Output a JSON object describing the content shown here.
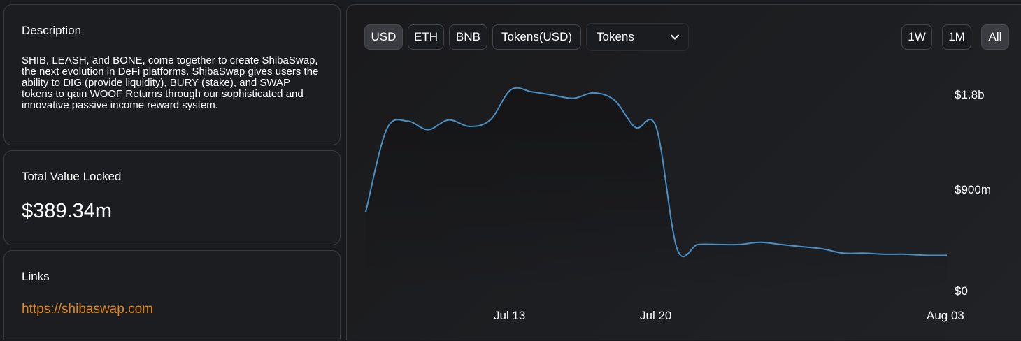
{
  "description": {
    "title": "Description",
    "text": "SHIB, LEASH, and BONE, come together to create ShibaSwap, the next evolution in DeFi platforms. ShibaSwap gives users the ability to DIG (provide liquidity), BURY (stake), and SWAP tokens to gain WOOF Returns through our sophisticated and innovative passive income reward system."
  },
  "tvl": {
    "title": "Total Value Locked",
    "value": "$389.34m"
  },
  "links": {
    "title": "Links",
    "url": "https://shibaswap.com"
  },
  "toolbar": {
    "currency_buttons": [
      "USD",
      "ETH",
      "BNB",
      "Tokens(USD)"
    ],
    "active_currency": "USD",
    "select_value": "Tokens",
    "range_buttons": [
      "1W",
      "1M",
      "All"
    ],
    "active_range": "All"
  },
  "colors": {
    "line": "#4a8fc4",
    "link": "#e0871c"
  },
  "chart_data": {
    "type": "area",
    "y_tick_labels": [
      "$1.8b",
      "$900m",
      "$0"
    ],
    "x_tick_labels": [
      "Jul 13",
      "Jul 20",
      "Aug 03"
    ],
    "ylim": [
      0,
      1800000000
    ],
    "x": [
      "Jul 6",
      "Jul 7",
      "Jul 8",
      "Jul 9",
      "Jul 10",
      "Jul 11",
      "Jul 12",
      "Jul 13",
      "Jul 14",
      "Jul 15",
      "Jul 16",
      "Jul 17",
      "Jul 18",
      "Jul 19",
      "Jul 20",
      "Jul 21",
      "Jul 22",
      "Jul 23",
      "Jul 24",
      "Jul 25",
      "Jul 26",
      "Jul 27",
      "Jul 28",
      "Jul 29",
      "Jul 30",
      "Jul 31",
      "Aug 01",
      "Aug 02",
      "Aug 03"
    ],
    "series": [
      {
        "values": [
          720000000,
          1480000000,
          1560000000,
          1480000000,
          1570000000,
          1510000000,
          1570000000,
          1850000000,
          1830000000,
          1800000000,
          1770000000,
          1820000000,
          1750000000,
          1500000000,
          1500000000,
          380000000,
          420000000,
          420000000,
          420000000,
          440000000,
          420000000,
          400000000,
          380000000,
          340000000,
          340000000,
          330000000,
          330000000,
          320000000,
          320000000
        ]
      }
    ],
    "grid": false,
    "legend": "none"
  }
}
